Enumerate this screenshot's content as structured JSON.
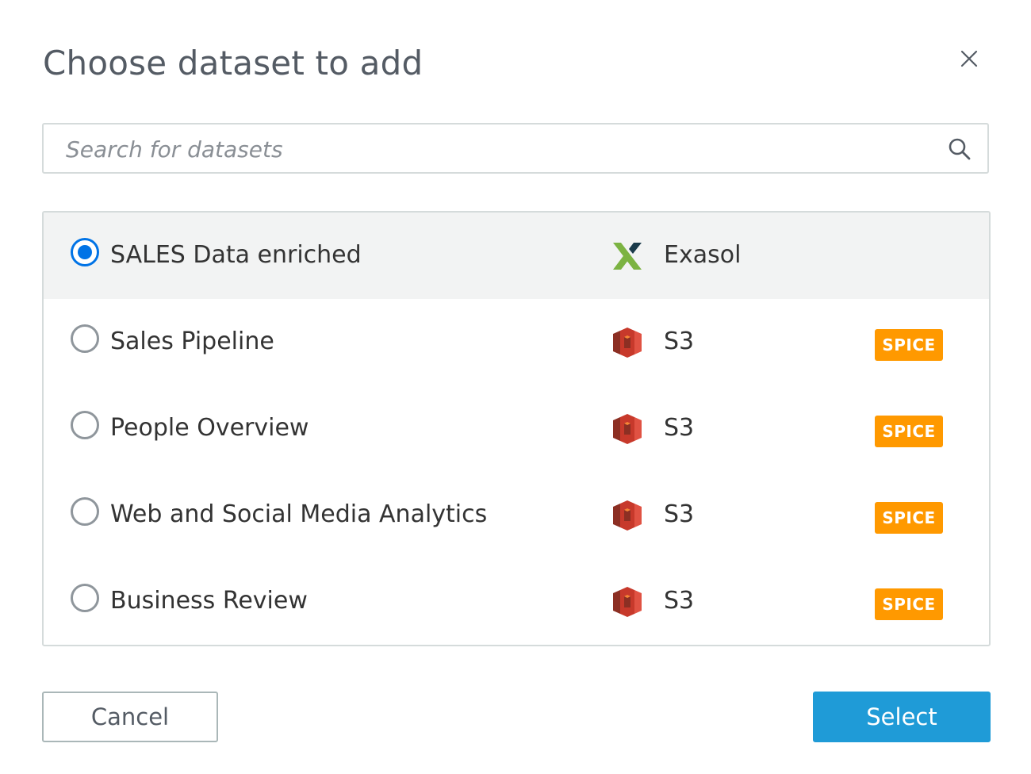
{
  "dialog": {
    "title": "Choose dataset to add",
    "close_icon": "close-icon"
  },
  "search": {
    "placeholder": "Search for datasets",
    "value": "",
    "icon": "search-icon"
  },
  "datasets": [
    {
      "name": "SALES Data enriched",
      "source": "Exasol",
      "source_icon": "exasol-logo-icon",
      "badge": "",
      "selected": true
    },
    {
      "name": "Sales Pipeline",
      "source": "S3",
      "source_icon": "s3-bucket-icon",
      "badge": "SPICE",
      "selected": false
    },
    {
      "name": "People Overview",
      "source": "S3",
      "source_icon": "s3-bucket-icon",
      "badge": "SPICE",
      "selected": false
    },
    {
      "name": "Web and Social Media Analytics",
      "source": "S3",
      "source_icon": "s3-bucket-icon",
      "badge": "SPICE",
      "selected": false
    },
    {
      "name": "Business Review",
      "source": "S3",
      "source_icon": "s3-bucket-icon",
      "badge": "SPICE",
      "selected": false
    }
  ],
  "footer": {
    "cancel_label": "Cancel",
    "select_label": "Select"
  },
  "colors": {
    "radio_selected": "#0073e6",
    "spice_badge": "#ff9900",
    "select_button": "#1f9bd7",
    "selected_row_bg": "#f2f3f3"
  }
}
